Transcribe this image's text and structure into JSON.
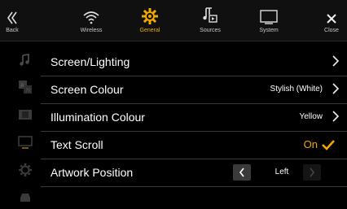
{
  "topbar": {
    "tabs": [
      {
        "label": "Back",
        "icon": "back-icon"
      },
      {
        "label": "Wireless",
        "icon": "wireless-icon"
      },
      {
        "label": "General",
        "icon": "gear-icon",
        "active": true
      },
      {
        "label": "Sources",
        "icon": "music-note-icon"
      },
      {
        "label": "System",
        "icon": "monitor-icon"
      },
      {
        "label": "Close",
        "icon": "close-icon"
      }
    ]
  },
  "sidebar": {
    "icons": [
      "music-note-icon",
      "language-icon",
      "filmstrip-icon",
      "display-icon",
      "gear-icon",
      "car-icon"
    ]
  },
  "rows": [
    {
      "label": "Screen/Lighting",
      "value": ""
    },
    {
      "label": "Screen Colour",
      "value": "Stylish (White)"
    },
    {
      "label": "Illumination Colour",
      "value": "Yellow"
    },
    {
      "label": "Text Scroll",
      "value": "On"
    },
    {
      "label": "Artwork Position",
      "value": "Left"
    }
  ],
  "colors": {
    "accent": "#f0a800",
    "background": "#000000",
    "divider": "#3a3a3a"
  }
}
